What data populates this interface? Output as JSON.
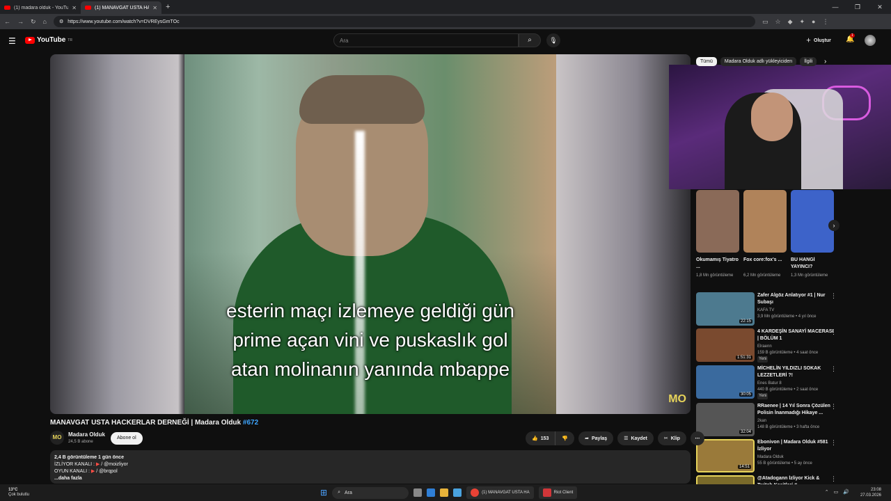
{
  "browser": {
    "tabs": [
      {
        "title": "(1) madara olduk - YouTube",
        "active": false
      },
      {
        "title": "(1) MANAVGAT USTA HACK",
        "active": true
      }
    ],
    "url": "https://www.youtube.com/watch?v=DVREysGmTOc"
  },
  "header": {
    "logo": "YouTube",
    "logo_sup": "TR",
    "search_placeholder": "Ara",
    "create_label": "Oluştur",
    "notif_count": "1"
  },
  "player": {
    "subtitles": [
      "esterin maçı izlemeye geldiği gün",
      "prime açan vini ve puskaslık gol",
      "atan molinanın yanında mbappe"
    ],
    "watermark": "MO"
  },
  "video": {
    "title": "MANAVGAT USTA HACKERLAR DERNEĞİ | Madara Olduk",
    "tag": "#672",
    "channel": "Madara Olduk",
    "channel_avatar": "MO",
    "subscribers": "24,5 B abone",
    "subscribe_label": "Abone ol",
    "likes": "153",
    "share_label": "Paylaş",
    "save_label": "Kaydet",
    "clip_label": "Klip",
    "description": {
      "stats": "2,4 B görüntüleme  1 gün önce",
      "line1": "İZLİYOR KANALI : ",
      "line1_handle": "/ @moizliyor",
      "line2": "OYUN KANALI : ",
      "line2_handle": "/ @brqpol",
      "more": "...daha fazla"
    }
  },
  "sidebar": {
    "chips": [
      {
        "label": "Tümü",
        "selected": true
      },
      {
        "label": "Madara Olduk adlı yükleyiciden",
        "selected": false
      },
      {
        "label": "İlgili",
        "selected": false
      }
    ],
    "shorts": [
      {
        "title": "Okumamış Tiyatro ...",
        "views": "1,8 Mn görüntüleme",
        "color": "#8a6a58"
      },
      {
        "title": "Fox core:fox's ...",
        "views": "6,2 Mn görüntüleme",
        "color": "#b0835a"
      },
      {
        "title": "BU HANGİ YAYINCI?",
        "views": "1,3 Mn görüntüleme",
        "color": "#3d63c9"
      }
    ],
    "recommendations": [
      {
        "title": "Zafer Algöz Anlatıyor #1 | Nur Subaşı",
        "channel": "KAFA TV",
        "stats": "3,9 Mn görüntüleme • 4 yıl önce",
        "duration": "22:15",
        "badge": "",
        "color": "#4d7a8f"
      },
      {
        "title": "4 KARDEŞİN SANAYİ MACERASI | BÖLÜM 1",
        "channel": "Elraenn",
        "stats": "159 B görüntüleme • 4 saat önce",
        "duration": "1:51:31",
        "badge": "Yeni",
        "color": "#7a4a2f"
      },
      {
        "title": "MİCHELİN YILDIZLI SOKAK LEZZETLERİ ?!",
        "channel": "Enes Batur 8",
        "stats": "440 B görüntüleme • 2 saat önce",
        "duration": "30:05",
        "badge": "Yeni",
        "color": "#3a6a9e"
      },
      {
        "title": "RRaenee | 14 Yıl Sonra Çözülen Polisin İnanmadığı Hikaye ...",
        "channel": "2kan",
        "stats": "148 B görüntüleme • 3 hafta önce",
        "duration": "32:04",
        "badge": "",
        "color": "#555"
      },
      {
        "title": "Ebonivon | Madara Olduk #581 İzliyor",
        "channel": "Madara Olduk",
        "stats": "55 B görüntüleme • 5 ay önce",
        "duration": "14:51",
        "badge": "",
        "color": "#9a7a3a"
      },
      {
        "title": "@Atadogann İzliyor Kick & Twitch Kesitleri #...",
        "channel": "",
        "stats": "",
        "duration": "",
        "badge": "",
        "color": "#7a6a2a"
      }
    ]
  },
  "taskbar": {
    "weather_temp": "13°C",
    "weather_desc": "Çok bulutlu",
    "search": "Ara",
    "apps": [
      "(1) MANAVGAT USTA HA",
      "Riot Client"
    ],
    "time": "23:08",
    "date": "27.03.2026"
  }
}
